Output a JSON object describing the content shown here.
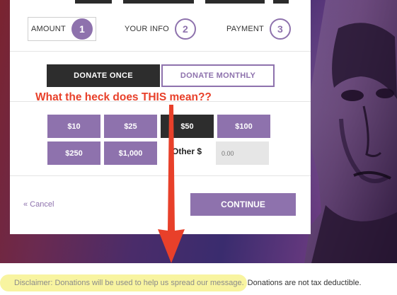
{
  "steps": [
    {
      "label": "AMOUNT",
      "number": "1",
      "state": "active"
    },
    {
      "label": "YOUR INFO",
      "number": "2",
      "state": "inactive"
    },
    {
      "label": "PAYMENT",
      "number": "3",
      "state": "inactive"
    }
  ],
  "frequency": {
    "once_label": "DONATE ONCE",
    "monthly_label": "DONATE MONTHLY",
    "selected": "once"
  },
  "amounts": [
    {
      "label": "$10",
      "selected": false
    },
    {
      "label": "$25",
      "selected": false
    },
    {
      "label": "$50",
      "selected": true
    },
    {
      "label": "$100",
      "selected": false
    },
    {
      "label": "$250",
      "selected": false
    },
    {
      "label": "$1,000",
      "selected": false
    }
  ],
  "other": {
    "label": "Other $",
    "placeholder": "0.00"
  },
  "actions": {
    "cancel_label": "« Cancel",
    "continue_label": "CONTINUE"
  },
  "annotation": {
    "text": "What the heck does THIS mean??"
  },
  "disclaimer": {
    "highlighted": "Disclaimer: Donations will be used to help us spread our message.",
    "rest": " Donations are not tax deductible."
  },
  "colors": {
    "accent": "#8e72ad",
    "selected": "#2d2d2d",
    "annotation": "#e8402a",
    "highlight": "#f8f4a0"
  }
}
